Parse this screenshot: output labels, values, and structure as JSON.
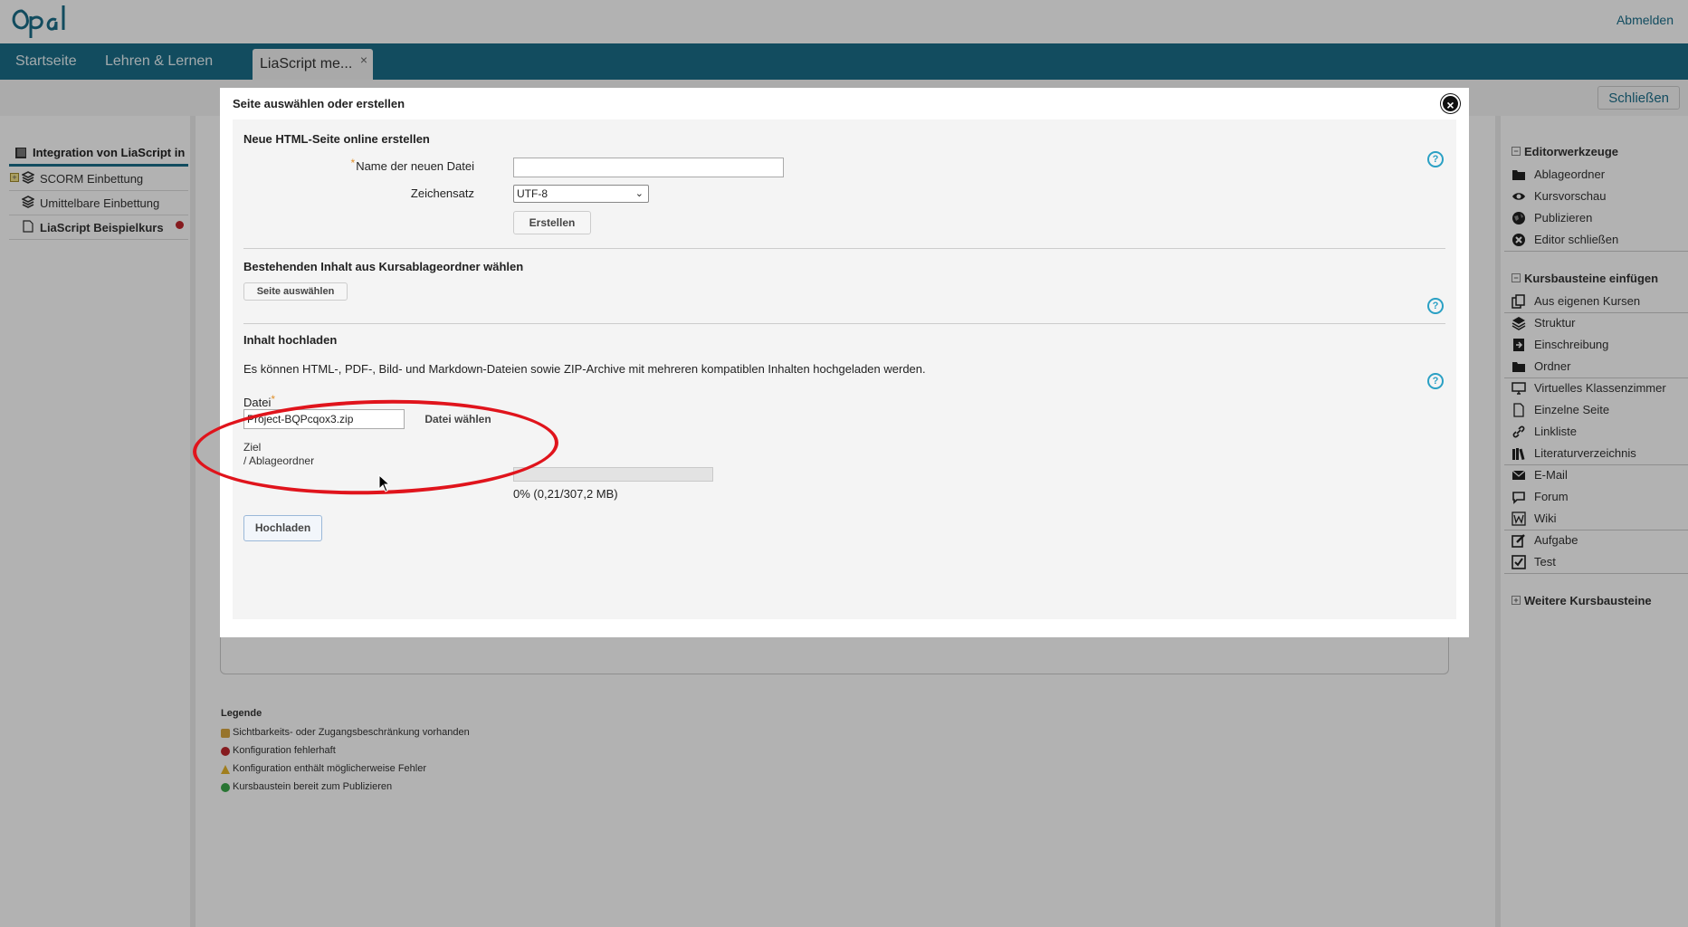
{
  "header": {
    "logo_text": "Opal",
    "logout": "Abmelden",
    "nav": [
      "Startseite",
      "Lehren & Lernen"
    ],
    "active_tab": "LiaScript me...",
    "tab_close": "×",
    "close_button": "Schließen"
  },
  "tree": {
    "root": "Integration von LiaScript in",
    "items": [
      {
        "label": "SCORM Einbettung",
        "icon": "layers-icon"
      },
      {
        "label": "Umittelbare Einbettung",
        "icon": "layers-icon"
      },
      {
        "label": "LiaScript Beispielkurs",
        "icon": "page-icon"
      }
    ]
  },
  "right_panel": {
    "editor_tools_title": "Editorwerkzeuge",
    "editor_tools": [
      "Ablageordner",
      "Kursvorschau",
      "Publizieren",
      "Editor schließen"
    ],
    "insert_title": "Kursbausteine einfügen",
    "insert_items": [
      "Aus eigenen Kursen",
      "Struktur",
      "Einschreibung",
      "Ordner",
      "Virtuelles Klassenzimmer",
      "Einzelne Seite",
      "Linkliste",
      "Literaturverzeichnis",
      "E-Mail",
      "Forum",
      "Wiki",
      "Aufgabe",
      "Test"
    ],
    "more_title": "Weitere Kursbausteine"
  },
  "legend": {
    "title": "Legende",
    "items": [
      {
        "label": "Sichtbarkeits- oder Zugangsbeschränkung vorhanden",
        "color": "#d9a640"
      },
      {
        "label": "Konfiguration fehlerhaft",
        "color": "#c0282d"
      },
      {
        "label": "Konfiguration enthält möglicherweise Fehler",
        "color": "#e5b52b"
      },
      {
        "label": "Kursbaustein bereit zum Publizieren",
        "color": "#3aa84a"
      }
    ]
  },
  "modal": {
    "title": "Seite auswählen oder erstellen",
    "close": "×",
    "help": "?",
    "new_section": {
      "title": "Neue HTML-Seite online erstellen",
      "name_label": "Name der neuen Datei",
      "name_value": "",
      "charset_label": "Zeichensatz",
      "charset_value": "UTF-8",
      "create_button": "Erstellen"
    },
    "existing_section": {
      "title": "Bestehenden Inhalt aus Kursablageordner wählen",
      "select_button": "Seite auswählen"
    },
    "upload_section": {
      "title": "Inhalt hochladen",
      "description": "Es können HTML-, PDF-, Bild- und Markdown-Dateien sowie ZIP-Archive mit mehreren kompatiblen Inhalten hochgeladen werden.",
      "file_label": "Datei",
      "file_value": "Project-BQPcqox3.zip",
      "choose_button": "Datei wählen",
      "target_label": "Ziel",
      "target_value": "/ Ablageordner",
      "progress_percent": 0,
      "progress_text": "0% (0,21/307,2 MB)",
      "upload_button": "Hochladen"
    }
  },
  "colors": {
    "brand": "#1b6e88",
    "highlight": "#e0141c",
    "help": "#2aa0c4"
  }
}
